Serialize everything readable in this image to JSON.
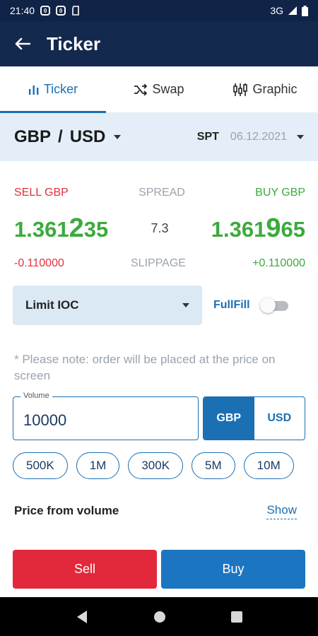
{
  "status_bar": {
    "time": "21:40",
    "network": "3G"
  },
  "app_bar": {
    "title": "Ticker"
  },
  "tabs": [
    {
      "label": "Ticker",
      "icon": "bar-chart-icon",
      "active": true
    },
    {
      "label": "Swap",
      "icon": "shuffle-icon",
      "active": false
    },
    {
      "label": "Graphic",
      "icon": "candlestick-icon",
      "active": false
    }
  ],
  "pair": {
    "base": "GBP",
    "separator": "/",
    "quote": "USD",
    "tenor": "SPT",
    "date": "06.12.2021"
  },
  "quote": {
    "sell_label": "SELL GBP",
    "spread_label": "SPREAD",
    "buy_label": "BUY GBP",
    "sell_prefix": "1.361",
    "sell_big": "2",
    "sell_suffix": "35",
    "spread_value": "7.3",
    "buy_prefix": "1.361",
    "buy_big": "9",
    "buy_suffix": "65",
    "sell_diff": "-0.110000",
    "slippage_label": "SLIPPAGE",
    "buy_diff": "+0.110000"
  },
  "order": {
    "type": "Limit IOC",
    "fullfill_label": "FullFill",
    "fullfill_on": false
  },
  "note": "* Please note: order will be placed at the price on screen",
  "volume": {
    "label": "Volume",
    "value": "10000",
    "currencies": [
      "GBP",
      "USD"
    ],
    "selected_currency": "GBP"
  },
  "quick_amounts": [
    "500K",
    "1M",
    "300K",
    "5M",
    "10M"
  ],
  "price_from_volume": {
    "label": "Price from volume",
    "link": "Show"
  },
  "actions": {
    "sell": "Sell",
    "buy": "Buy"
  },
  "colors": {
    "app_bar": "#14294e",
    "accent": "#1b6fb3",
    "sell": "#e2283b",
    "buy_price": "#3caa3c",
    "buy_button": "#1c75c1"
  }
}
